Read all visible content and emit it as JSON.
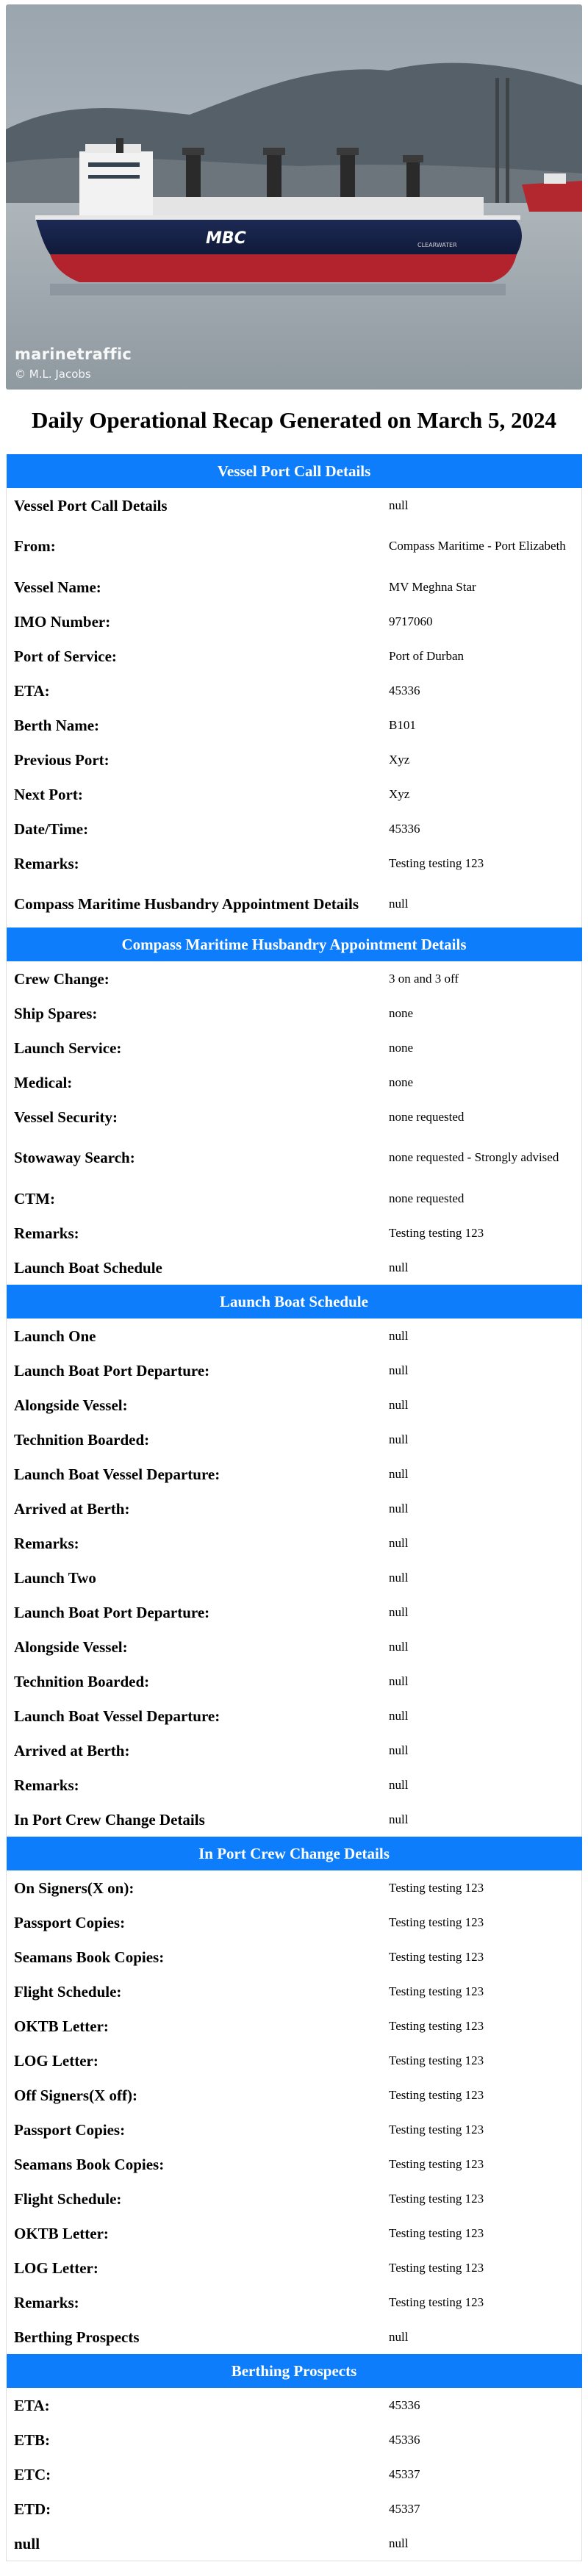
{
  "photo": {
    "brand": "marinetraffic",
    "credit": "© M.L. Jacobs",
    "hull_text": "MBC",
    "hull_name": "CLEARWATER"
  },
  "report": {
    "title": "Daily Operational Recap Generated on March 5, 2024"
  },
  "sections": {
    "vessel_port_call": {
      "header": "Vessel Port Call Details",
      "rows": [
        {
          "label": "Vessel Port Call Details",
          "value": "null"
        },
        {
          "label": "From:",
          "value": "Compass Maritime - Port Elizabeth"
        },
        {
          "label": "Vessel Name:",
          "value": "MV Meghna Star"
        },
        {
          "label": "IMO Number:",
          "value": "9717060"
        },
        {
          "label": "Port of Service:",
          "value": "Port of Durban"
        },
        {
          "label": "ETA:",
          "value": "45336"
        },
        {
          "label": "Berth Name:",
          "value": "B101"
        },
        {
          "label": "Previous Port:",
          "value": "Xyz"
        },
        {
          "label": "Next Port:",
          "value": "Xyz"
        },
        {
          "label": "Date/Time:",
          "value": "45336"
        },
        {
          "label": "Remarks:",
          "value": "Testing testing 123"
        },
        {
          "label": "Compass Maritime Husbandry Appointment Details",
          "value": "null"
        }
      ]
    },
    "husbandry": {
      "header": "Compass Maritime Husbandry Appointment Details",
      "rows": [
        {
          "label": "Crew Change:",
          "value": "3 on and 3 off"
        },
        {
          "label": "Ship Spares:",
          "value": "none"
        },
        {
          "label": "Launch Service:",
          "value": "none"
        },
        {
          "label": "Medical:",
          "value": "none"
        },
        {
          "label": "Vessel Security:",
          "value": "none requested"
        },
        {
          "label": "Stowaway Search:",
          "value": "none requested - Strongly advised"
        },
        {
          "label": "CTM:",
          "value": "none requested"
        },
        {
          "label": "Remarks:",
          "value": "Testing testing 123"
        },
        {
          "label": "Launch Boat Schedule",
          "value": "null"
        }
      ]
    },
    "launch_boat": {
      "header": "Launch Boat Schedule",
      "rows": [
        {
          "label": "Launch One",
          "value": "null"
        },
        {
          "label": "Launch Boat Port Departure:",
          "value": "null"
        },
        {
          "label": "Alongside Vessel:",
          "value": "null"
        },
        {
          "label": "Technition Boarded:",
          "value": "null"
        },
        {
          "label": "Launch Boat Vessel Departure:",
          "value": "null"
        },
        {
          "label": "Arrived at Berth:",
          "value": "null"
        },
        {
          "label": "Remarks:",
          "value": "null"
        },
        {
          "label": "Launch Two",
          "value": "null"
        },
        {
          "label": "Launch Boat Port Departure:",
          "value": "null"
        },
        {
          "label": "Alongside Vessel:",
          "value": "null"
        },
        {
          "label": "Technition Boarded:",
          "value": "null"
        },
        {
          "label": "Launch Boat Vessel Departure:",
          "value": "null"
        },
        {
          "label": "Arrived at Berth:",
          "value": "null"
        },
        {
          "label": "Remarks:",
          "value": "null"
        },
        {
          "label": "In Port Crew Change Details",
          "value": "null"
        }
      ]
    },
    "crew_change": {
      "header": "In Port Crew Change Details",
      "rows": [
        {
          "label": "On Signers(X on):",
          "value": "Testing testing 123"
        },
        {
          "label": "Passport Copies:",
          "value": "Testing testing 123"
        },
        {
          "label": "Seamans Book Copies:",
          "value": "Testing testing 123"
        },
        {
          "label": "Flight Schedule:",
          "value": "Testing testing 123"
        },
        {
          "label": "OKTB Letter:",
          "value": "Testing testing 123"
        },
        {
          "label": "LOG Letter:",
          "value": "Testing testing 123"
        },
        {
          "label": "Off Signers(X off):",
          "value": "Testing testing 123"
        },
        {
          "label": "Passport Copies:",
          "value": "Testing testing 123"
        },
        {
          "label": "Seamans Book Copies:",
          "value": "Testing testing 123"
        },
        {
          "label": "Flight Schedule:",
          "value": "Testing testing 123"
        },
        {
          "label": "OKTB Letter:",
          "value": "Testing testing 123"
        },
        {
          "label": "LOG Letter:",
          "value": "Testing testing 123"
        },
        {
          "label": "Remarks:",
          "value": "Testing testing 123"
        },
        {
          "label": "Berthing Prospects",
          "value": "null"
        }
      ]
    },
    "berthing": {
      "header": "Berthing Prospects",
      "rows": [
        {
          "label": "ETA:",
          "value": "45336"
        },
        {
          "label": "ETB:",
          "value": "45336"
        },
        {
          "label": "ETC:",
          "value": "45337"
        },
        {
          "label": "ETD:",
          "value": "45337"
        },
        {
          "label": "null",
          "value": "null"
        }
      ]
    }
  }
}
